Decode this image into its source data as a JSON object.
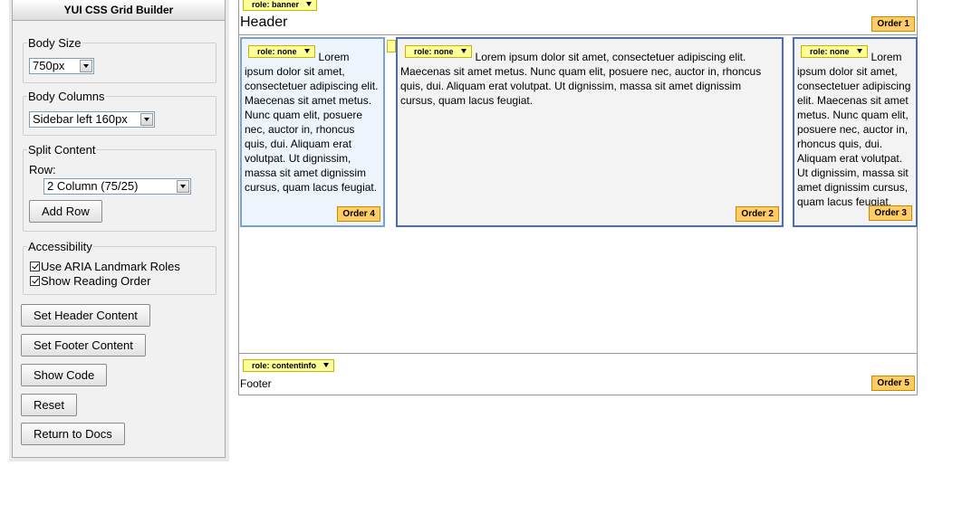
{
  "panel": {
    "title": "YUI CSS Grid Builder",
    "body_size": {
      "legend": "Body Size",
      "value": "750px"
    },
    "body_columns": {
      "legend": "Body Columns",
      "value": "Sidebar left 160px"
    },
    "split_content": {
      "legend": "Split Content",
      "row_label": "Row:",
      "row_value": "2 Column (75/25)",
      "add_row": "Add Row"
    },
    "accessibility": {
      "legend": "Accessibility",
      "aria_label": "Use ARIA Landmark Roles",
      "aria_checked": true,
      "order_label": "Show Reading Order",
      "order_checked": true
    },
    "buttons": {
      "set_header": "Set Header Content",
      "set_footer": "Set Footer Content",
      "show_code": "Show Code",
      "reset": "Reset",
      "return_docs": "Return to Docs"
    }
  },
  "grid": {
    "header": {
      "role": "role: banner",
      "text": "Header",
      "order": "Order 1"
    },
    "sidebar": {
      "role": "role: none",
      "text": "Lorem ipsum dolor sit amet, consectetuer adipiscing elit. Maecenas sit amet metus. Nunc quam elit, posuere nec, auctor in, rhoncus quis, dui. Aliquam erat volutpat. Ut dignissim, massa sit amet dignissim cursus, quam lacus feugiat.",
      "order": "Order 4"
    },
    "main": {
      "role": "role: none",
      "text": "Lorem ipsum dolor sit amet, consectetuer adipiscing elit. Maecenas sit amet metus. Nunc quam elit, posuere nec, auctor in, rhoncus quis, dui. Aliquam erat volutpat. Ut dignissim, massa sit amet dignissim cursus, quam lacus feugiat.",
      "order": "Order 2"
    },
    "right": {
      "role": "role: none",
      "text": "Lorem ipsum dolor sit amet, consectetuer adipiscing elit. Maecenas sit amet metus. Nunc quam elit, posuere nec, auctor in, rhoncus quis, dui. Aliquam erat volutpat. Ut dignissim, massa sit amet dignissim cursus, quam lacus feugiat.",
      "order": "Order 3"
    },
    "footer": {
      "role": "role: contentinfo",
      "text": "Footer",
      "order": "Order 5"
    }
  },
  "colors": {
    "role_bg": "#ffff99",
    "order_bg": "#ffcc66",
    "unit_border": "#4a6cc2"
  }
}
